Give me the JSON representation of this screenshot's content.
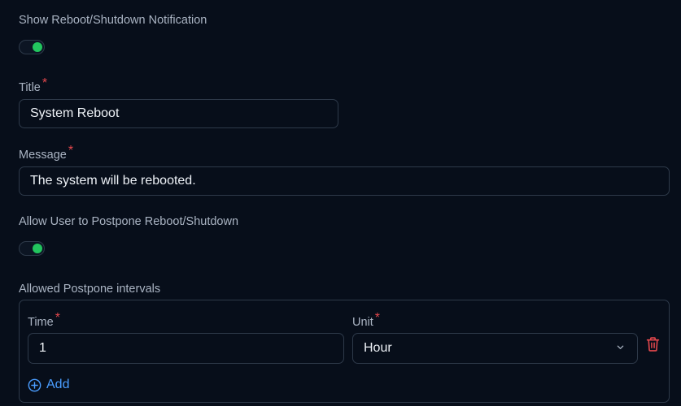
{
  "notification": {
    "show_label": "Show Reboot/Shutdown Notification",
    "show_enabled": true,
    "title_label": "Title",
    "title_required": "*",
    "title_value": "System Reboot",
    "message_label": "Message",
    "message_required": "*",
    "message_value": "The system will be rebooted."
  },
  "postpone": {
    "allow_label": "Allow User to Postpone Reboot/Shutdown",
    "allow_enabled": true,
    "intervals_label": "Allowed Postpone intervals",
    "time_label": "Time",
    "time_required": "*",
    "time_value": "1",
    "unit_label": "Unit",
    "unit_required": "*",
    "unit_value": "Hour",
    "add_label": "Add"
  },
  "colors": {
    "background": "#070e1a",
    "toggle_on": "#22c55e",
    "required": "#e5484d",
    "delete": "#e5484d",
    "link": "#4a9dff"
  },
  "icons": {
    "delete": "trash-icon",
    "add": "plus-circle-icon",
    "select": "chevron-down-icon"
  }
}
